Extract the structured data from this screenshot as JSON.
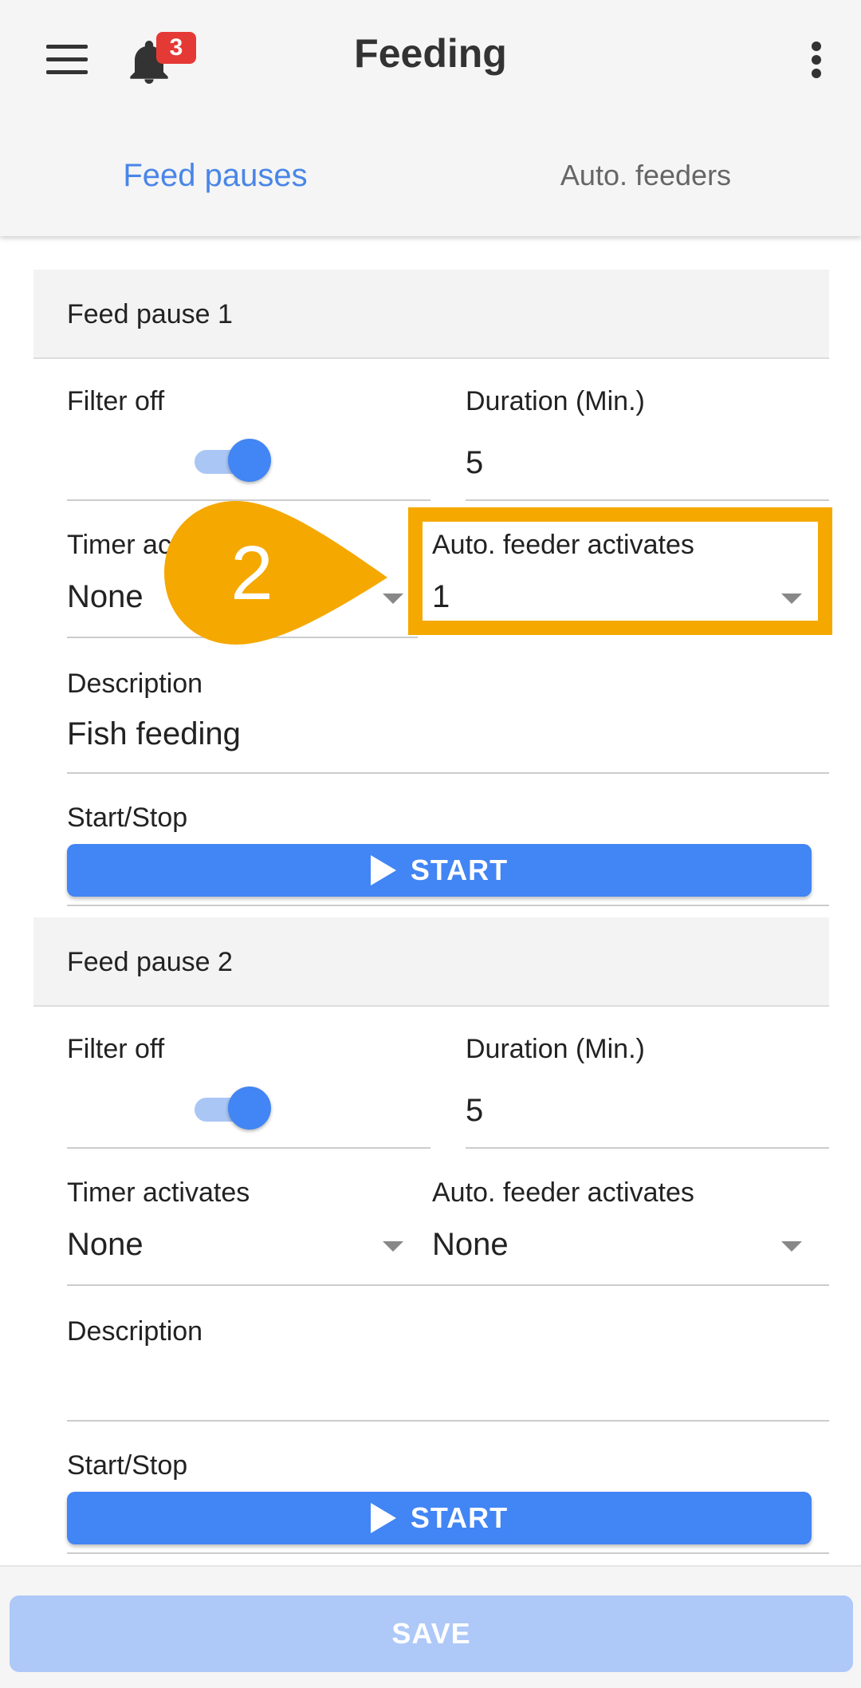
{
  "app_bar": {
    "title": "Feeding",
    "notification_count": "3",
    "tabs": [
      {
        "label": "Feed pauses",
        "active": true
      },
      {
        "label": "Auto. feeders",
        "active": false
      }
    ]
  },
  "callout": {
    "number": "2",
    "color": "#f5a800"
  },
  "feed_pauses": [
    {
      "header": "Feed pause 1",
      "filter_off_label": "Filter off",
      "filter_off_on": true,
      "duration_label": "Duration (Min.)",
      "duration_value": "5",
      "timer_label": "Timer ac",
      "timer_value": "None",
      "auto_feeder_label": "Auto. feeder activates",
      "auto_feeder_value": "1",
      "description_label": "Description",
      "description_value": "Fish feeding",
      "start_stop_label": "Start/Stop",
      "start_button": "START"
    },
    {
      "header": "Feed pause 2",
      "filter_off_label": "Filter off",
      "filter_off_on": true,
      "duration_label": "Duration (Min.)",
      "duration_value": "5",
      "timer_label": "Timer activates",
      "timer_value": "None",
      "auto_feeder_label": "Auto. feeder activates",
      "auto_feeder_value": "None",
      "description_label": "Description",
      "description_value": "",
      "start_stop_label": "Start/Stop",
      "start_button": "START"
    }
  ],
  "footer": {
    "save_label": "SAVE"
  },
  "colors": {
    "accent": "#4285f4",
    "tab_active": "#4a86e8",
    "badge": "#e53935",
    "save_disabled": "#aec8f8"
  }
}
